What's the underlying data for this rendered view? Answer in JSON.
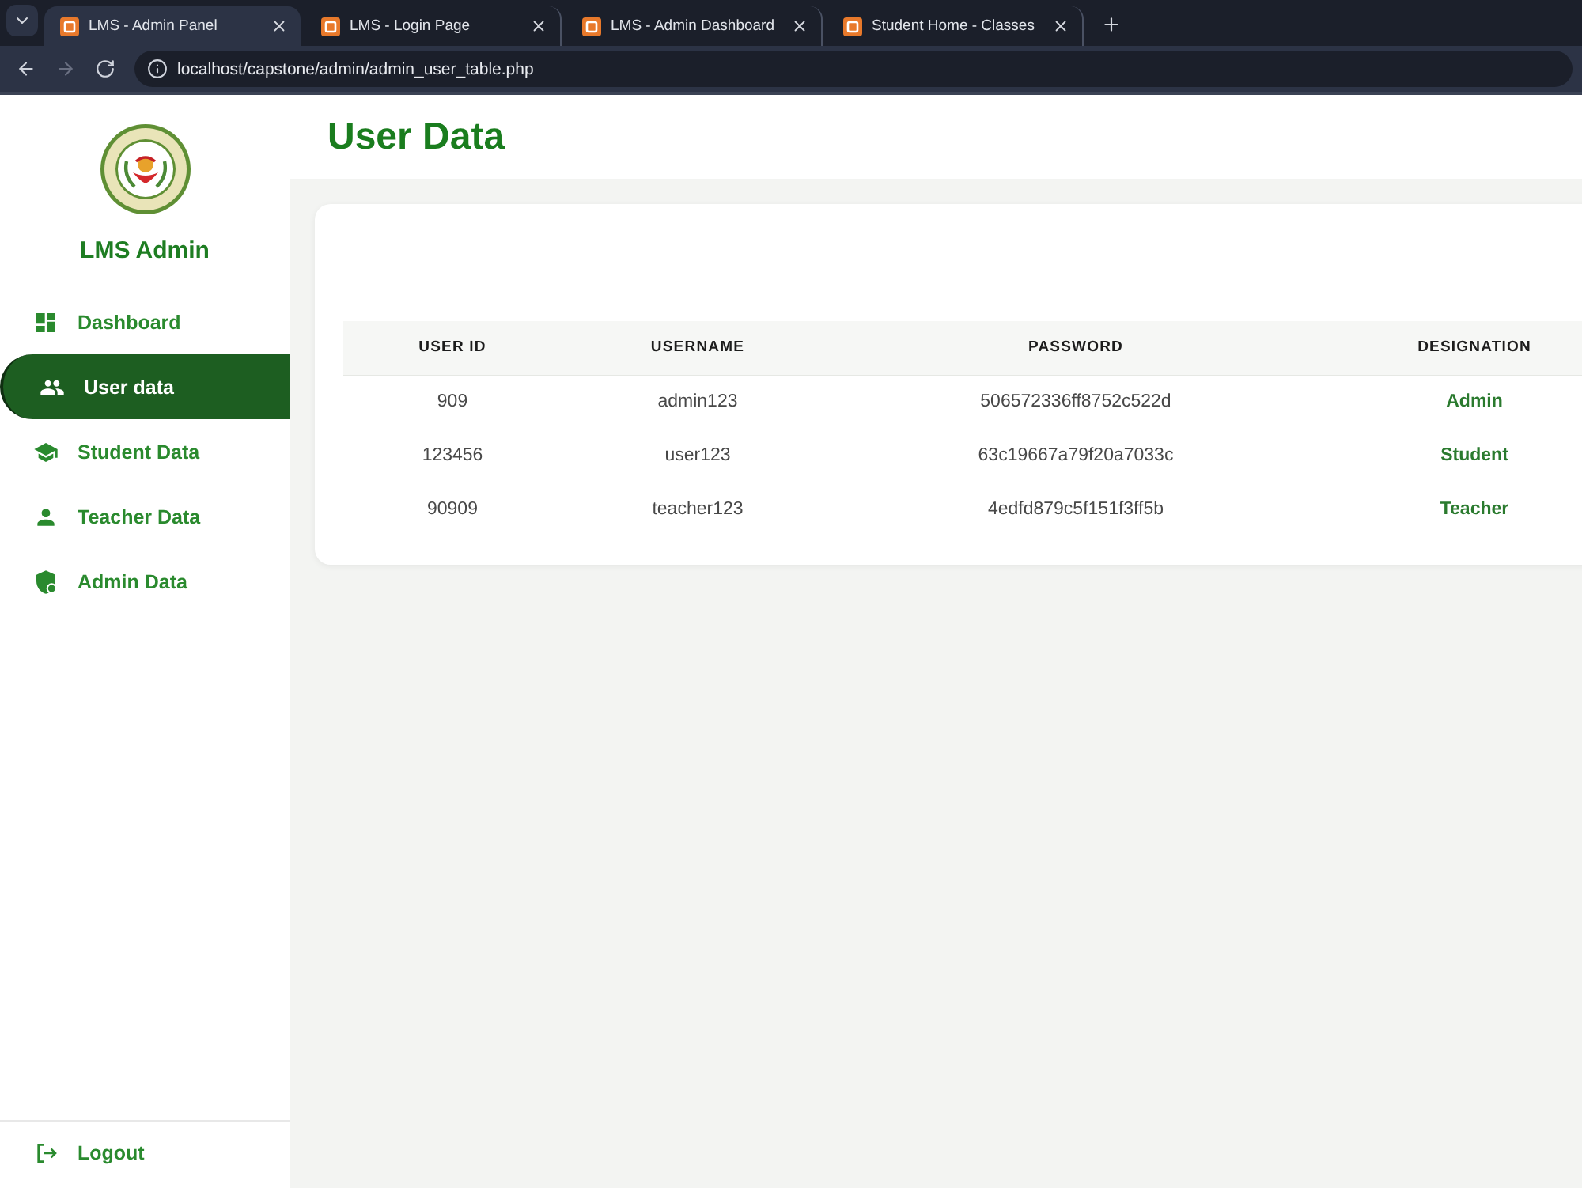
{
  "browser": {
    "tabs": [
      {
        "title": "LMS - Admin Panel",
        "selected": true
      },
      {
        "title": "LMS - Login Page",
        "selected": false
      },
      {
        "title": "LMS - Admin Dashboard",
        "selected": false
      },
      {
        "title": "Student Home - Classes",
        "selected": false
      }
    ],
    "nav_buttons": [
      {
        "kind": "back",
        "disabled": false
      },
      {
        "kind": "forward",
        "disabled": true
      },
      {
        "kind": "reload",
        "disabled": false
      }
    ],
    "address": "localhost/capstone/admin/admin_user_table.php"
  },
  "sidebar": {
    "title": "LMS Admin",
    "items": [
      {
        "label": "Dashboard",
        "selected": false
      },
      {
        "label": "User data",
        "selected": true
      },
      {
        "label": "Student Data",
        "selected": false
      },
      {
        "label": "Teacher Data",
        "selected": false
      },
      {
        "label": "Admin Data",
        "selected": false
      }
    ],
    "logout": "Logout"
  },
  "page": {
    "title": "User Data"
  },
  "table": {
    "columns": [
      "USER ID",
      "USERNAME",
      "PASSWORD",
      "DESIGNATION"
    ],
    "rows": [
      [
        "909",
        "admin123",
        "506572336ff8752c522d",
        "Admin"
      ],
      [
        "123456",
        "user123",
        "63c19667a79f20a7033c",
        "Student"
      ],
      [
        "90909",
        "teacher123",
        "4edfd879c5f151f3ff5b",
        "Teacher"
      ]
    ]
  }
}
